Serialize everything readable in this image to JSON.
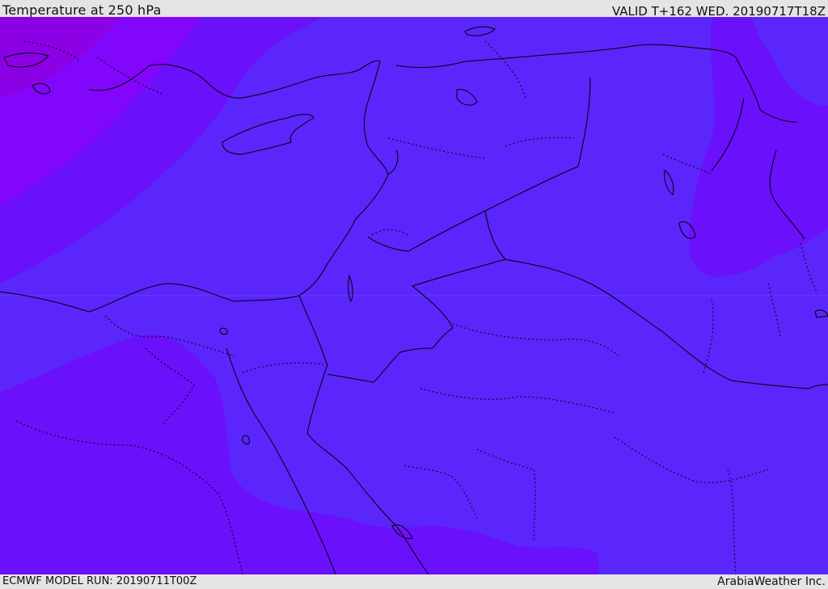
{
  "header": {
    "title": "Temperature at 250 hPa",
    "valid": "VALID T+162 WED. 20190717T18Z"
  },
  "footer": {
    "model_run": "ECMWF MODEL RUN: 20190711T00Z",
    "credit": "ArabiaWeather Inc."
  },
  "map": {
    "field": "temperature",
    "pressure_level_hpa": 250,
    "colors": {
      "base": "#5a26fc",
      "warm_band": "#6a10fb",
      "hot_band": "#8206fb",
      "hottest_band": "#8c00e6",
      "boundaries": "#000000"
    }
  }
}
